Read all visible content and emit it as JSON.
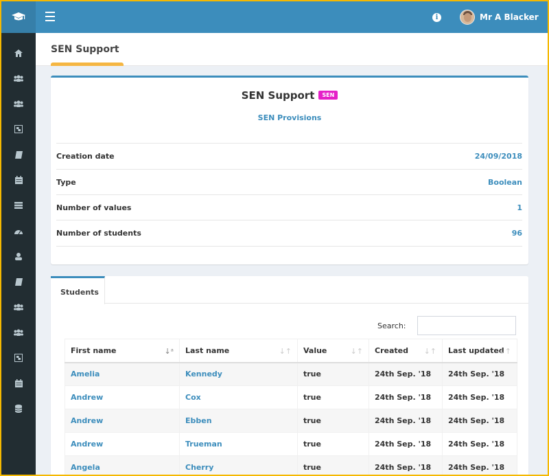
{
  "header": {
    "user_name": "Mr A Blacker",
    "info_icon": "info-icon",
    "menu_icon": "bars-icon",
    "logo_icon": "graduation-cap-icon",
    "accent_color": "#3c8dbc"
  },
  "sidebar": {
    "items": [
      {
        "icon": "home-icon"
      },
      {
        "icon": "users-icon"
      },
      {
        "icon": "users-icon"
      },
      {
        "icon": "object-group-icon"
      },
      {
        "icon": "book-icon"
      },
      {
        "icon": "calendar-icon"
      },
      {
        "icon": "list-icon"
      },
      {
        "icon": "dashboard-icon"
      },
      {
        "icon": "user-icon"
      },
      {
        "icon": "book-icon"
      },
      {
        "icon": "users-icon"
      },
      {
        "icon": "users-icon"
      },
      {
        "icon": "object-group-icon"
      },
      {
        "icon": "calendar-icon"
      },
      {
        "icon": "database-icon"
      }
    ]
  },
  "page": {
    "title": "SEN Support"
  },
  "detail": {
    "title": "SEN Support",
    "badge": "SEN",
    "badge_color": "#e520c8",
    "link": "SEN Provisions",
    "rows": [
      {
        "label": "Creation date",
        "value": "24/09/2018"
      },
      {
        "label": "Type",
        "value": "Boolean"
      },
      {
        "label": "Number of values",
        "value": "1"
      },
      {
        "label": "Number of students",
        "value": "96"
      }
    ]
  },
  "students": {
    "tab_label": "Students",
    "search_label": "Search:",
    "search_value": "",
    "columns": [
      "First name",
      "Last name",
      "Value",
      "Created",
      "Last updated"
    ],
    "rows": [
      [
        "Amelia",
        "Kennedy",
        "true",
        "24th Sep. '18",
        "24th Sep. '18"
      ],
      [
        "Andrew",
        "Cox",
        "true",
        "24th Sep. '18",
        "24th Sep. '18"
      ],
      [
        "Andrew",
        "Ebben",
        "true",
        "24th Sep. '18",
        "24th Sep. '18"
      ],
      [
        "Andrew",
        "Trueman",
        "true",
        "24th Sep. '18",
        "24th Sep. '18"
      ],
      [
        "Angela",
        "Cherry",
        "true",
        "24th Sep. '18",
        "24th Sep. '18"
      ]
    ]
  }
}
